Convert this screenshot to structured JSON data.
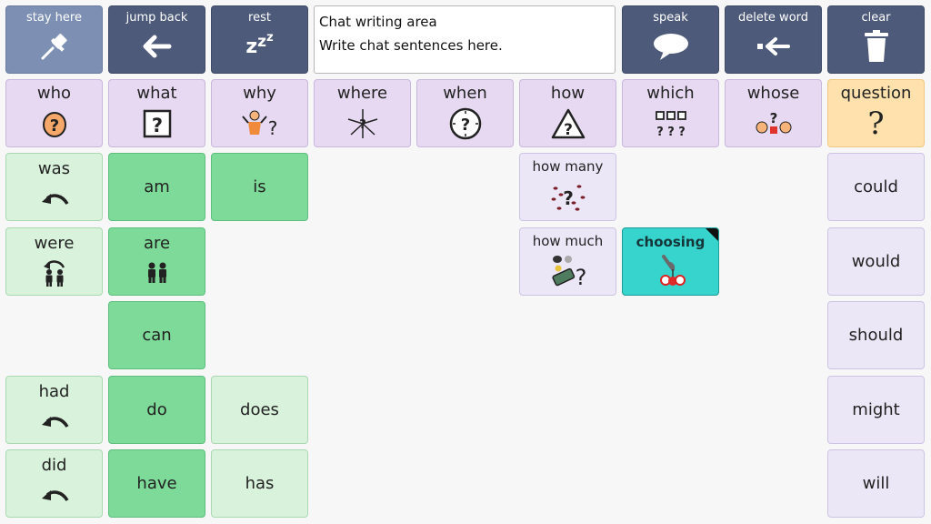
{
  "toolbar": {
    "stay_here": "stay here",
    "jump_back": "jump back",
    "rest": "rest",
    "speak": "speak",
    "delete_word": "delete word",
    "clear": "clear"
  },
  "chat": {
    "title": "Chat writing area",
    "placeholder": "Write chat sentences here."
  },
  "questions": {
    "who": "who",
    "what": "what",
    "why": "why",
    "where": "where",
    "when": "when",
    "how": "how",
    "which": "which",
    "whose": "whose",
    "question": "question"
  },
  "verbs": {
    "was": "was",
    "am": "am",
    "is": "is",
    "were": "were",
    "are": "are",
    "can": "can",
    "had": "had",
    "do": "do",
    "does": "does",
    "did": "did",
    "have": "have",
    "has": "has"
  },
  "quantity": {
    "how_many": "how many",
    "how_much": "how much"
  },
  "choosing": "choosing",
  "modals": {
    "could": "could",
    "would": "would",
    "should": "should",
    "might": "might",
    "will": "will"
  },
  "icons": {
    "rest_glyph": "zzz",
    "question_glyph": "?"
  },
  "colors": {
    "toolbar": "#4d5a79",
    "toolbar_light": "#7d8fb3",
    "question_bg": "#e6d9f1",
    "question_highlight": "#ffe1ad",
    "verb_light": "#d9f2dc",
    "verb_dark": "#7dda98",
    "modal_bg": "#ece7f7",
    "choosing_bg": "#37d3cd"
  }
}
